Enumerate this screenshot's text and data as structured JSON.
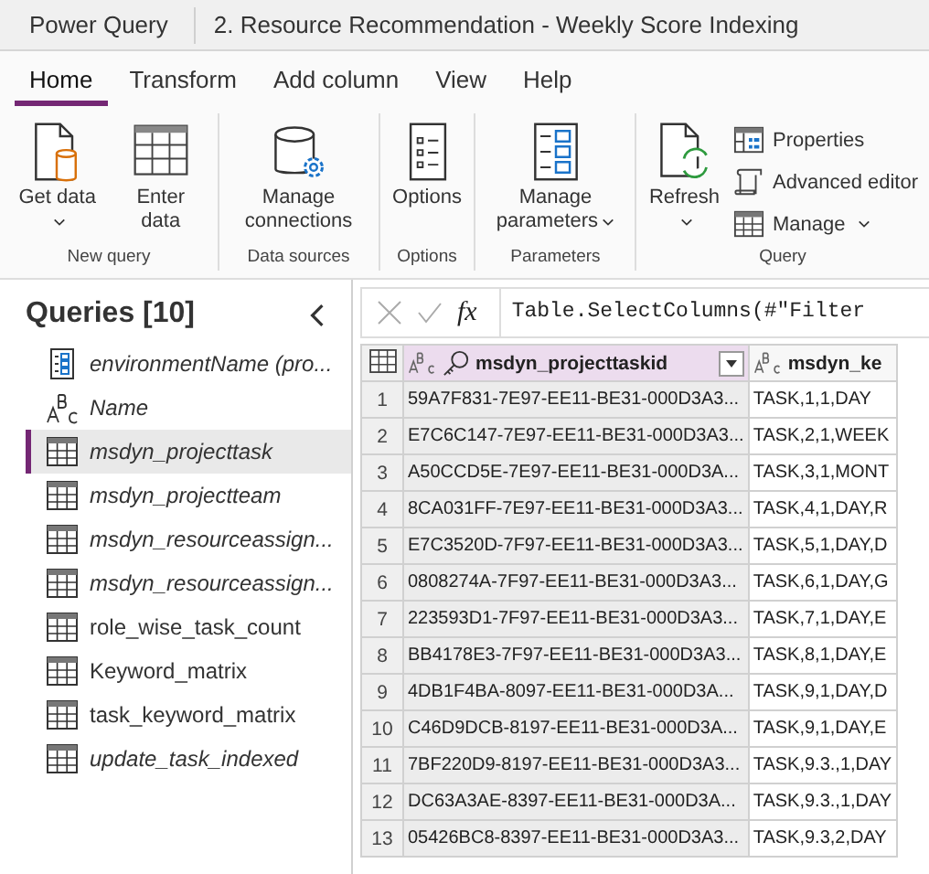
{
  "window": {
    "app": "Power Query",
    "title": "2. Resource Recommendation - Weekly Score Indexing"
  },
  "tabs": [
    {
      "label": "Home",
      "selected": true
    },
    {
      "label": "Transform",
      "selected": false
    },
    {
      "label": "Add column",
      "selected": false
    },
    {
      "label": "View",
      "selected": false
    },
    {
      "label": "Help",
      "selected": false
    }
  ],
  "ribbon": [
    {
      "group": "New query",
      "buttons": [
        {
          "kind": "getdata",
          "label": "Get data",
          "dropdown": true
        },
        {
          "kind": "enterdata",
          "label": "Enter data",
          "dropdown": false
        }
      ]
    },
    {
      "group": "Data sources",
      "buttons": [
        {
          "kind": "connections",
          "label": "Manage connections",
          "dropdown": false
        }
      ]
    },
    {
      "group": "Options",
      "buttons": [
        {
          "kind": "options",
          "label": "Options",
          "dropdown": false
        }
      ]
    },
    {
      "group": "Parameters",
      "buttons": [
        {
          "kind": "parameters",
          "label": "Manage parameters",
          "dropdown": true
        }
      ]
    },
    {
      "group": "Query",
      "buttons": [
        {
          "kind": "refresh",
          "label": "Refresh",
          "dropdown": true
        }
      ],
      "small": [
        {
          "kind": "properties",
          "label": "Properties",
          "dropdown": false
        },
        {
          "kind": "editor",
          "label": "Advanced editor",
          "dropdown": false
        },
        {
          "kind": "manage",
          "label": "Manage",
          "dropdown": true
        }
      ]
    }
  ],
  "queries": {
    "title": "Queries [10]",
    "items": [
      {
        "kind": "parameter",
        "name": "environmentName (pro...",
        "italic": true,
        "selected": false
      },
      {
        "kind": "text",
        "name": "Name",
        "italic": true,
        "selected": false
      },
      {
        "kind": "table",
        "name": "msdyn_projecttask",
        "italic": true,
        "selected": true
      },
      {
        "kind": "table",
        "name": "msdyn_projectteam",
        "italic": true,
        "selected": false
      },
      {
        "kind": "table",
        "name": "msdyn_resourceassign...",
        "italic": true,
        "selected": false
      },
      {
        "kind": "table",
        "name": "msdyn_resourceassign...",
        "italic": true,
        "selected": false
      },
      {
        "kind": "table",
        "name": "role_wise_task_count",
        "italic": false,
        "selected": false
      },
      {
        "kind": "table",
        "name": "Keyword_matrix",
        "italic": false,
        "selected": false
      },
      {
        "kind": "table",
        "name": "task_keyword_matrix",
        "italic": false,
        "selected": false
      },
      {
        "kind": "table",
        "name": "update_task_indexed",
        "italic": true,
        "selected": false
      }
    ]
  },
  "formula": {
    "fx": "fx",
    "text": "Table.SelectColumns(#\"Filter"
  },
  "table": {
    "columns": [
      {
        "name": "msdyn_projecttaskid",
        "key": true,
        "selected": true
      },
      {
        "name": "msdyn_ke",
        "key": false,
        "selected": false
      }
    ],
    "rows": [
      {
        "n": "1",
        "cells": [
          "59A7F831-7E97-EE11-BE31-000D3A3...",
          "TASK,1,1,DAY"
        ]
      },
      {
        "n": "2",
        "cells": [
          "E7C6C147-7E97-EE11-BE31-000D3A3...",
          "TASK,2,1,WEEK"
        ]
      },
      {
        "n": "3",
        "cells": [
          "A50CCD5E-7E97-EE11-BE31-000D3A...",
          "TASK,3,1,MONT"
        ]
      },
      {
        "n": "4",
        "cells": [
          "8CA031FF-7E97-EE11-BE31-000D3A3...",
          "TASK,4,1,DAY,R"
        ]
      },
      {
        "n": "5",
        "cells": [
          "E7C3520D-7F97-EE11-BE31-000D3A3...",
          "TASK,5,1,DAY,D"
        ]
      },
      {
        "n": "6",
        "cells": [
          "0808274A-7F97-EE11-BE31-000D3A3...",
          "TASK,6,1,DAY,G"
        ]
      },
      {
        "n": "7",
        "cells": [
          "223593D1-7F97-EE11-BE31-000D3A3...",
          "TASK,7,1,DAY,E"
        ]
      },
      {
        "n": "8",
        "cells": [
          "BB4178E3-7F97-EE11-BE31-000D3A3...",
          "TASK,8,1,DAY,E"
        ]
      },
      {
        "n": "9",
        "cells": [
          "4DB1F4BA-8097-EE11-BE31-000D3A...",
          "TASK,9,1,DAY,D"
        ]
      },
      {
        "n": "10",
        "cells": [
          "C46D9DCB-8197-EE11-BE31-000D3A...",
          "TASK,9,1,DAY,E"
        ]
      },
      {
        "n": "11",
        "cells": [
          "7BF220D9-8197-EE11-BE31-000D3A3...",
          "TASK,9.3.,1,DAY"
        ]
      },
      {
        "n": "12",
        "cells": [
          "DC63A3AE-8397-EE11-BE31-000D3A...",
          "TASK,9.3.,1,DAY"
        ]
      },
      {
        "n": "13",
        "cells": [
          "05426BC8-8397-EE11-BE31-000D3A3...",
          "TASK,9.3,2,DAY"
        ]
      }
    ]
  }
}
